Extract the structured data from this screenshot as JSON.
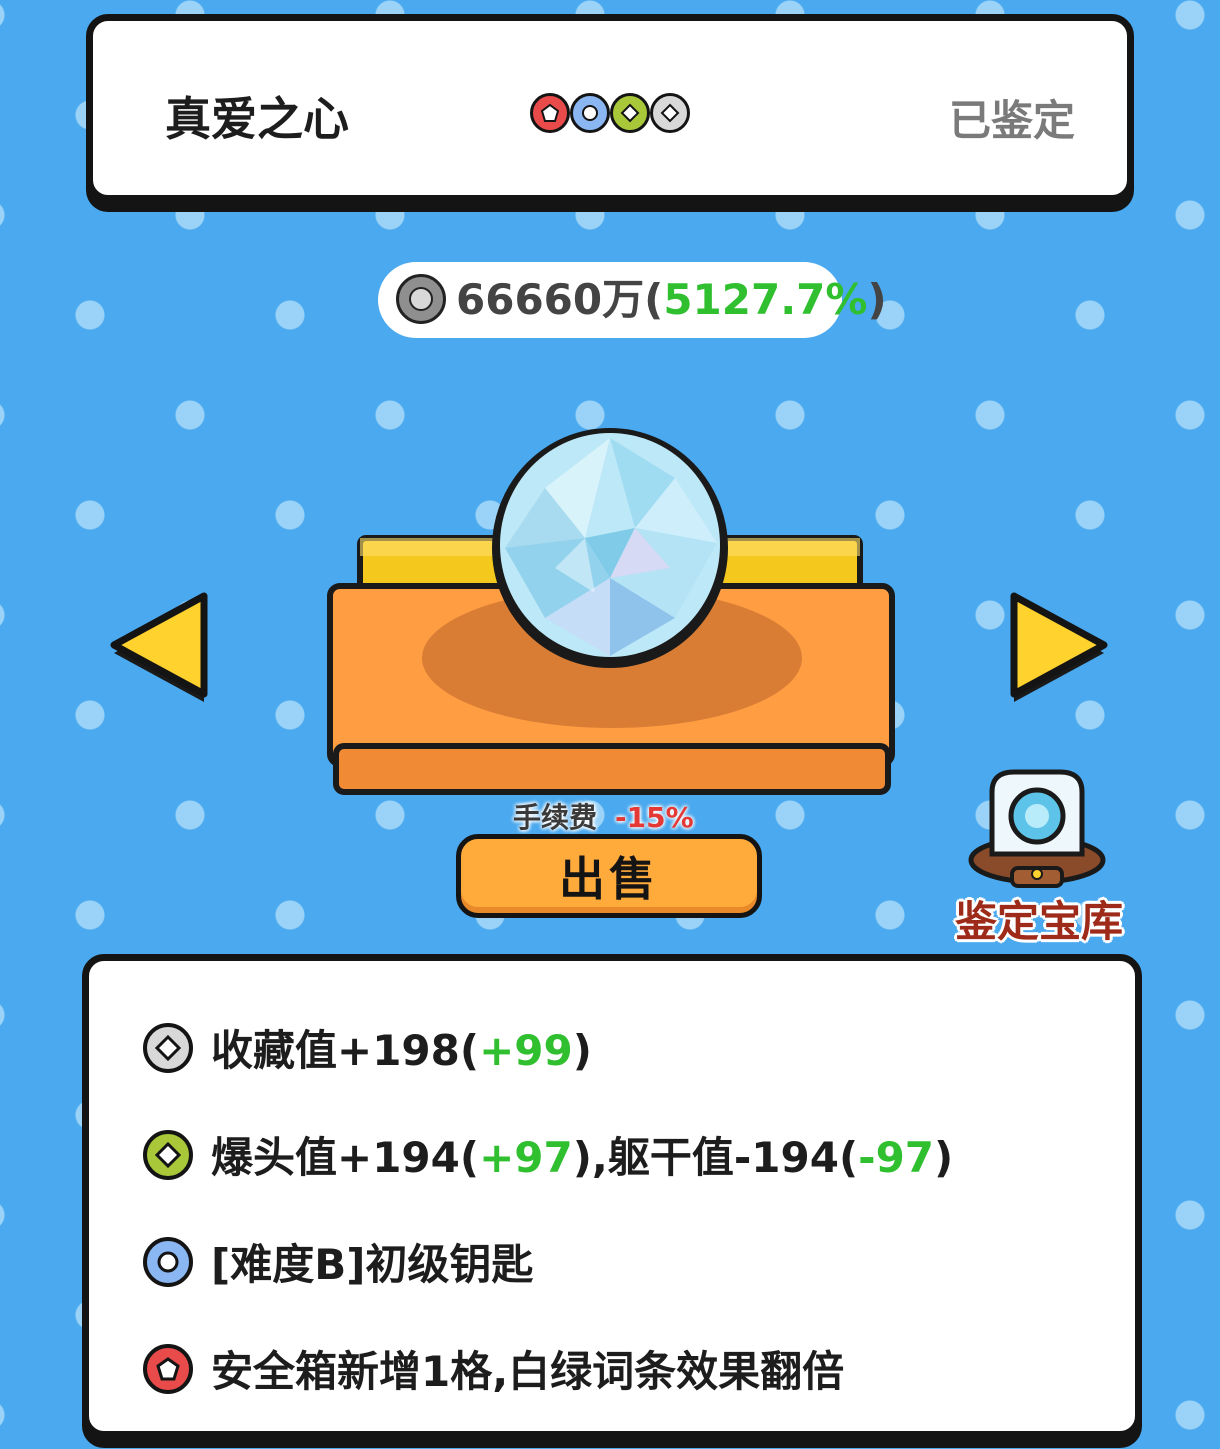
{
  "header": {
    "item_name": "真爱之心",
    "status": "已鉴定",
    "gem_dots": [
      {
        "icon": "red-pentagon-gem-icon",
        "color": "#e94b4b",
        "shape": "pentagon"
      },
      {
        "icon": "blue-circle-gem-icon",
        "color": "#8ab6f2",
        "shape": "circle"
      },
      {
        "icon": "green-diamond-gem-icon",
        "color": "#a8c83a",
        "shape": "diamond"
      },
      {
        "icon": "white-diamond-gem-icon",
        "color": "#d8d8d8",
        "shape": "diamond"
      }
    ]
  },
  "price": {
    "icon": "silver-coin-icon",
    "amount": "66660万",
    "open_paren": "(",
    "percent": "5127.7%",
    "close_paren": ")"
  },
  "item": {
    "icon": "diamond-gem-icon"
  },
  "fee": {
    "label": "手续费",
    "value": "-15%"
  },
  "sell_button": {
    "label": "出售"
  },
  "vault": {
    "label": "鉴定宝库",
    "icon": "appraisal-vault-icon"
  },
  "effects": [
    {
      "icon": "white-diamond-gem-icon",
      "color": "#d8d8d8",
      "shape": "diamond",
      "parts": [
        {
          "text": "收藏值+198(",
          "green": false
        },
        {
          "text": "+99",
          "green": true
        },
        {
          "text": ")",
          "green": false
        }
      ]
    },
    {
      "icon": "green-diamond-gem-icon",
      "color": "#a8c83a",
      "shape": "diamond",
      "parts": [
        {
          "text": "爆头值+194(",
          "green": false
        },
        {
          "text": "+97",
          "green": true
        },
        {
          "text": "),躯干值-194(",
          "green": false
        },
        {
          "text": "-97",
          "green": true
        },
        {
          "text": ")",
          "green": false
        }
      ]
    },
    {
      "icon": "blue-circle-gem-icon",
      "color": "#8ab6f2",
      "shape": "circle",
      "parts": [
        {
          "text": "[难度B]初级钥匙",
          "green": false
        }
      ]
    },
    {
      "icon": "red-pentagon-gem-icon",
      "color": "#e94b4b",
      "shape": "pentagon",
      "parts": [
        {
          "text": "安全箱新增1格,白绿词条效果翻倍",
          "green": false
        }
      ]
    }
  ],
  "colors": {
    "background": "#4aa9ef",
    "accent_green": "#2fbf2f",
    "fee_red": "#e53935",
    "button_orange": "#ffab3c"
  }
}
